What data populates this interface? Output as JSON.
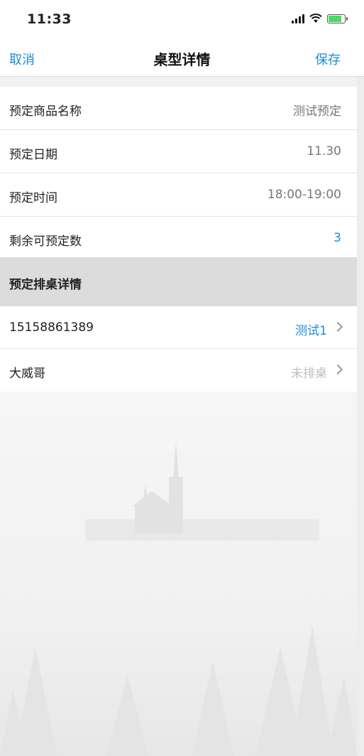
{
  "status_bar": {
    "time": "11:33",
    "icons": [
      "signal-icon",
      "wifi-icon",
      "battery-charging-icon"
    ]
  },
  "nav": {
    "cancel_label": "取消",
    "title": "桌型详情",
    "save_label": "保存",
    "accent_color": "#1d8ad8"
  },
  "details": {
    "rows": [
      {
        "label": "预定商品名称",
        "value": "测试预定"
      },
      {
        "label": "预定日期",
        "value": "11.30"
      },
      {
        "label": "预定时间",
        "value": "18:00-19:00"
      },
      {
        "label": "剩余可预定数",
        "value": "3"
      }
    ]
  },
  "table_section": {
    "title": "预定排桌详情",
    "rows": [
      {
        "label": "15158861389",
        "value": "测试1"
      },
      {
        "label": "大威哥",
        "value": "未排桌"
      }
    ]
  }
}
